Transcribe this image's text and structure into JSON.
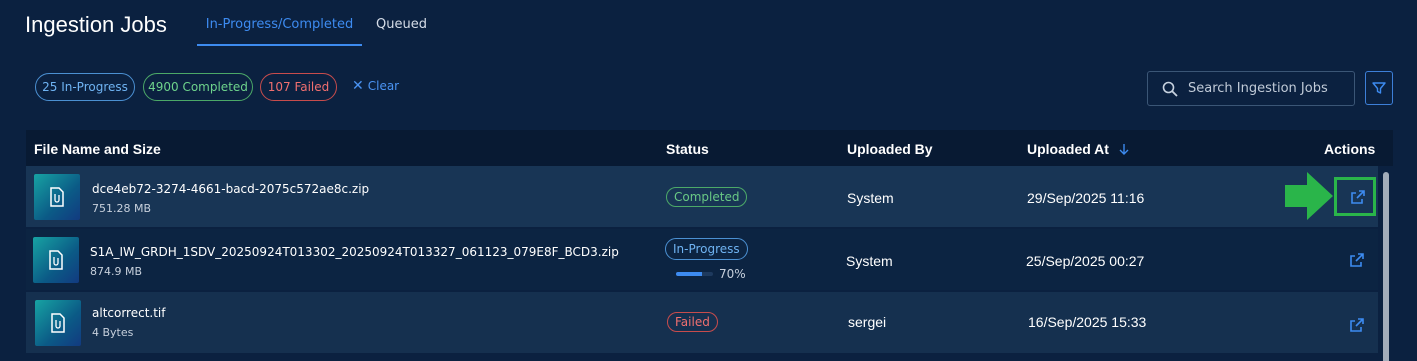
{
  "page": {
    "title": "Ingestion Jobs",
    "tabs": [
      {
        "label": "In-Progress/Completed",
        "active": true
      },
      {
        "label": "Queued",
        "active": false
      }
    ]
  },
  "filters": {
    "in_progress": "25 In-Progress",
    "completed": "4900 Completed",
    "failed": "107 Failed",
    "clear": "Clear",
    "search_placeholder": "Search Ingestion Jobs"
  },
  "table": {
    "columns": {
      "file": "File Name and Size",
      "status": "Status",
      "uploaded_by": "Uploaded By",
      "uploaded_at": "Uploaded At",
      "actions": "Actions"
    },
    "sort_column": "Uploaded At",
    "sort_direction": "descending",
    "rows": [
      {
        "name": "dce4eb72-3274-4661-bacd-2075c572ae8c.zip",
        "size": "751.28 MB",
        "status": "Completed",
        "uploaded_by": "System",
        "uploaded_at": "29/Sep/2025 11:16"
      },
      {
        "name": "S1A_IW_GRDH_1SDV_20250924T013302_20250924T013327_061123_079E8F_BCD3.zip",
        "size": "874.9 MB",
        "status": "In-Progress",
        "progress": 0.7,
        "progress_text": "70%",
        "uploaded_by": "System",
        "uploaded_at": "25/Sep/2025 00:27"
      },
      {
        "name": "altcorrect.tif",
        "size": "4 Bytes",
        "status": "Failed",
        "uploaded_by": "sergei",
        "uploaded_at": "16/Sep/2025 15:33"
      }
    ]
  },
  "icons": {
    "search": "search-icon",
    "filter": "filter-icon",
    "file": "file-attachment-icon",
    "open": "open-external-icon",
    "sort": "arrow-down-icon",
    "pointer": "arrow-right-icon"
  },
  "colors": {
    "accent": "#3d8bf0",
    "completed": "#4ca968",
    "in_progress": "#4b90d2",
    "failed": "#c84c4c",
    "highlight": "#2ab54a"
  }
}
